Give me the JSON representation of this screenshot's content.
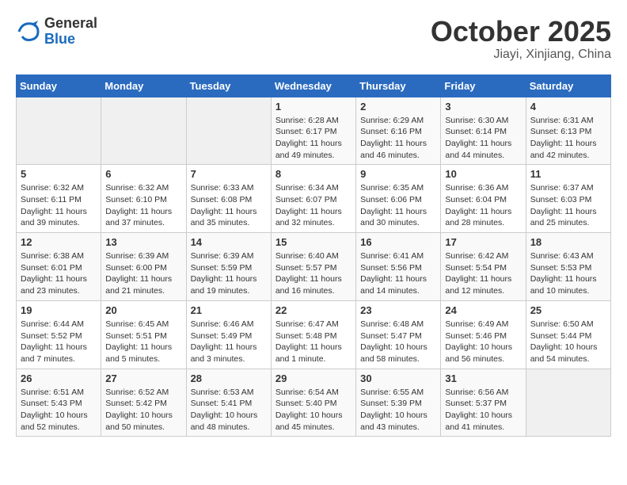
{
  "header": {
    "logo_general": "General",
    "logo_blue": "Blue",
    "month_title": "October 2025",
    "location": "Jiayi, Xinjiang, China"
  },
  "calendar": {
    "days_of_week": [
      "Sunday",
      "Monday",
      "Tuesday",
      "Wednesday",
      "Thursday",
      "Friday",
      "Saturday"
    ],
    "weeks": [
      [
        {
          "day": "",
          "info": ""
        },
        {
          "day": "",
          "info": ""
        },
        {
          "day": "",
          "info": ""
        },
        {
          "day": "1",
          "info": "Sunrise: 6:28 AM\nSunset: 6:17 PM\nDaylight: 11 hours and 49 minutes."
        },
        {
          "day": "2",
          "info": "Sunrise: 6:29 AM\nSunset: 6:16 PM\nDaylight: 11 hours and 46 minutes."
        },
        {
          "day": "3",
          "info": "Sunrise: 6:30 AM\nSunset: 6:14 PM\nDaylight: 11 hours and 44 minutes."
        },
        {
          "day": "4",
          "info": "Sunrise: 6:31 AM\nSunset: 6:13 PM\nDaylight: 11 hours and 42 minutes."
        }
      ],
      [
        {
          "day": "5",
          "info": "Sunrise: 6:32 AM\nSunset: 6:11 PM\nDaylight: 11 hours and 39 minutes."
        },
        {
          "day": "6",
          "info": "Sunrise: 6:32 AM\nSunset: 6:10 PM\nDaylight: 11 hours and 37 minutes."
        },
        {
          "day": "7",
          "info": "Sunrise: 6:33 AM\nSunset: 6:08 PM\nDaylight: 11 hours and 35 minutes."
        },
        {
          "day": "8",
          "info": "Sunrise: 6:34 AM\nSunset: 6:07 PM\nDaylight: 11 hours and 32 minutes."
        },
        {
          "day": "9",
          "info": "Sunrise: 6:35 AM\nSunset: 6:06 PM\nDaylight: 11 hours and 30 minutes."
        },
        {
          "day": "10",
          "info": "Sunrise: 6:36 AM\nSunset: 6:04 PM\nDaylight: 11 hours and 28 minutes."
        },
        {
          "day": "11",
          "info": "Sunrise: 6:37 AM\nSunset: 6:03 PM\nDaylight: 11 hours and 25 minutes."
        }
      ],
      [
        {
          "day": "12",
          "info": "Sunrise: 6:38 AM\nSunset: 6:01 PM\nDaylight: 11 hours and 23 minutes."
        },
        {
          "day": "13",
          "info": "Sunrise: 6:39 AM\nSunset: 6:00 PM\nDaylight: 11 hours and 21 minutes."
        },
        {
          "day": "14",
          "info": "Sunrise: 6:39 AM\nSunset: 5:59 PM\nDaylight: 11 hours and 19 minutes."
        },
        {
          "day": "15",
          "info": "Sunrise: 6:40 AM\nSunset: 5:57 PM\nDaylight: 11 hours and 16 minutes."
        },
        {
          "day": "16",
          "info": "Sunrise: 6:41 AM\nSunset: 5:56 PM\nDaylight: 11 hours and 14 minutes."
        },
        {
          "day": "17",
          "info": "Sunrise: 6:42 AM\nSunset: 5:54 PM\nDaylight: 11 hours and 12 minutes."
        },
        {
          "day": "18",
          "info": "Sunrise: 6:43 AM\nSunset: 5:53 PM\nDaylight: 11 hours and 10 minutes."
        }
      ],
      [
        {
          "day": "19",
          "info": "Sunrise: 6:44 AM\nSunset: 5:52 PM\nDaylight: 11 hours and 7 minutes."
        },
        {
          "day": "20",
          "info": "Sunrise: 6:45 AM\nSunset: 5:51 PM\nDaylight: 11 hours and 5 minutes."
        },
        {
          "day": "21",
          "info": "Sunrise: 6:46 AM\nSunset: 5:49 PM\nDaylight: 11 hours and 3 minutes."
        },
        {
          "day": "22",
          "info": "Sunrise: 6:47 AM\nSunset: 5:48 PM\nDaylight: 11 hours and 1 minute."
        },
        {
          "day": "23",
          "info": "Sunrise: 6:48 AM\nSunset: 5:47 PM\nDaylight: 10 hours and 58 minutes."
        },
        {
          "day": "24",
          "info": "Sunrise: 6:49 AM\nSunset: 5:46 PM\nDaylight: 10 hours and 56 minutes."
        },
        {
          "day": "25",
          "info": "Sunrise: 6:50 AM\nSunset: 5:44 PM\nDaylight: 10 hours and 54 minutes."
        }
      ],
      [
        {
          "day": "26",
          "info": "Sunrise: 6:51 AM\nSunset: 5:43 PM\nDaylight: 10 hours and 52 minutes."
        },
        {
          "day": "27",
          "info": "Sunrise: 6:52 AM\nSunset: 5:42 PM\nDaylight: 10 hours and 50 minutes."
        },
        {
          "day": "28",
          "info": "Sunrise: 6:53 AM\nSunset: 5:41 PM\nDaylight: 10 hours and 48 minutes."
        },
        {
          "day": "29",
          "info": "Sunrise: 6:54 AM\nSunset: 5:40 PM\nDaylight: 10 hours and 45 minutes."
        },
        {
          "day": "30",
          "info": "Sunrise: 6:55 AM\nSunset: 5:39 PM\nDaylight: 10 hours and 43 minutes."
        },
        {
          "day": "31",
          "info": "Sunrise: 6:56 AM\nSunset: 5:37 PM\nDaylight: 10 hours and 41 minutes."
        },
        {
          "day": "",
          "info": ""
        }
      ]
    ]
  }
}
